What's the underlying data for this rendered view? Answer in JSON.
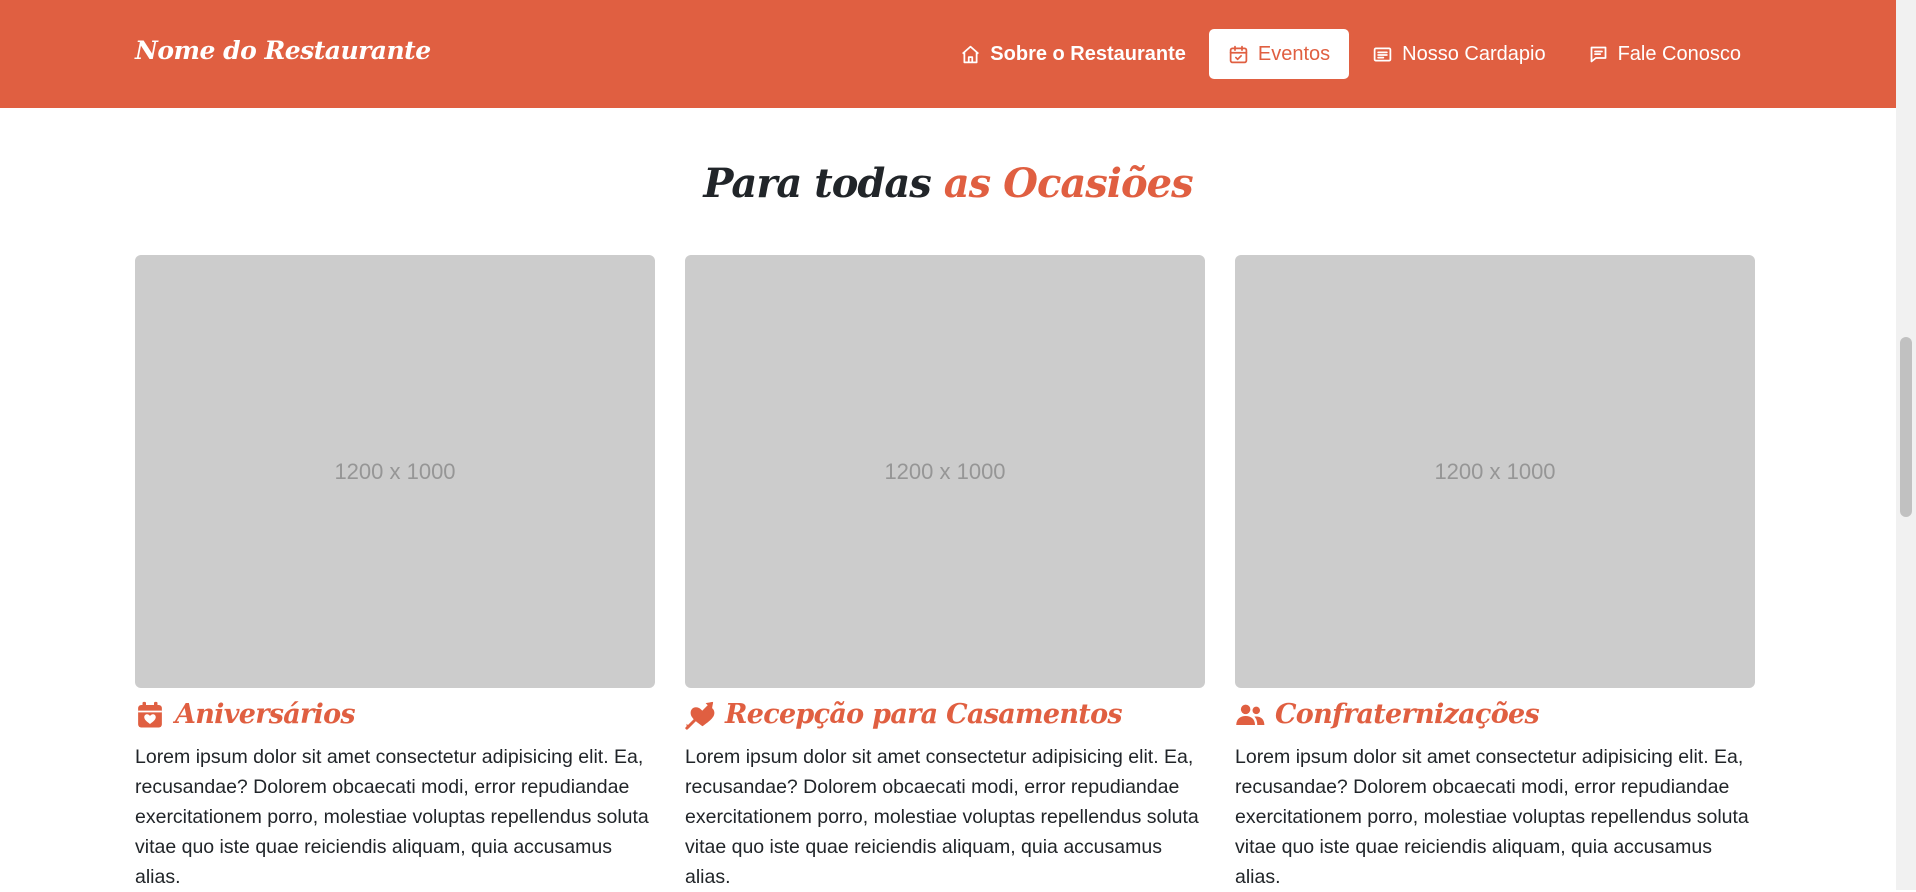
{
  "navbar": {
    "brand": "Nome do Restaurante",
    "items": [
      {
        "label": "Sobre o Restaurante",
        "icon": "home-icon",
        "active": false
      },
      {
        "label": "Eventos",
        "icon": "calendar-check-icon",
        "active": true
      },
      {
        "label": "Nosso Cardapio",
        "icon": "menu-card-icon",
        "active": false
      },
      {
        "label": "Fale Conosco",
        "icon": "chat-icon",
        "active": false
      }
    ]
  },
  "section": {
    "title_part1": "Para todas",
    "title_part2": "as Ocasiões"
  },
  "cards": [
    {
      "image_label": "1200 x 1000",
      "icon": "calendar-heart-icon",
      "title": "Aniversários",
      "text": "Lorem ipsum dolor sit amet consectetur adipisicing elit. Ea, recusandae? Dolorem obcaecati modi, error repudiandae exercitationem porro, molestiae voluptas repellendus soluta vitae quo iste quae reiciendis aliquam, quia accusamus alias."
    },
    {
      "image_label": "1200 x 1000",
      "icon": "heart-arrow-icon",
      "title": "Recepção para Casamentos",
      "text": "Lorem ipsum dolor sit amet consectetur adipisicing elit. Ea, recusandae? Dolorem obcaecati modi, error repudiandae exercitationem porro, molestiae voluptas repellendus soluta vitae quo iste quae reiciendis aliquam, quia accusamus alias."
    },
    {
      "image_label": "1200 x 1000",
      "icon": "user-group-icon",
      "title": "Confraternizações",
      "text": "Lorem ipsum dolor sit amet consectetur adipisicing elit. Ea, recusandae? Dolorem obcaecati modi, error repudiandae exercitationem porro, molestiae voluptas repellendus soluta vitae quo iste quae reiciendis aliquam, quia accusamus alias."
    }
  ],
  "colors": {
    "accent": "#e05f41",
    "placeholder": "#cccccc",
    "text": "#212529"
  }
}
